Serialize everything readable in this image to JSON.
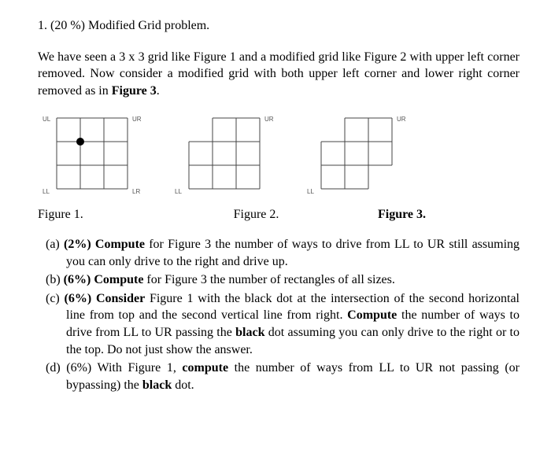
{
  "title": "1. (20 %) Modified Grid problem.",
  "intro_html": "We have seen a 3 x 3 grid like Figure 1 and a modified grid like Figure 2 with upper left corner removed. Now consider a modified grid with both upper left corner and lower right corner removed as in <strong>Figure 3</strong>.",
  "figures": {
    "fig1": {
      "caption": "Figure 1.",
      "labels": {
        "UL": "UL",
        "UR": "UR",
        "LL": "LL",
        "LR": "LR"
      }
    },
    "fig2": {
      "caption": "Figure 2.",
      "labels": {
        "UR": "UR",
        "LL": "LL"
      }
    },
    "fig3": {
      "caption": "Figure 3.",
      "labels": {
        "UR": "UR",
        "LL": "LL"
      }
    }
  },
  "parts": {
    "a": "(a) <strong>(2%) Compute</strong> for Figure 3 the number of ways to drive from LL to UR still assuming you can only drive to the right and drive up.",
    "b": "(b) <strong>(6%) Compute</strong> for Figure 3 the number of rectangles of all sizes.",
    "c": "(c) <strong>(6%) Consider</strong> Figure 1 with the black dot at the intersection of the second horizontal line from top and the second vertical line from right. <strong>Compute</strong> the number of ways to drive from LL to UR passing the <strong>black</strong> dot assuming you can only drive to the right or to the top. Do not just show the answer.",
    "d": "(d) (6%) With Figure 1, <strong>compute</strong> the number of ways from LL to UR not passing (or bypassing) the <strong>black</strong> dot."
  },
  "chart_data": [
    {
      "type": "table",
      "name": "Figure 1",
      "description": "3x3 full grid with corner labels UL, UR, LL, LR and a black dot at intersection (col 2 from left, row 1 from top inside grid lines)",
      "grid_rows": 3,
      "grid_cols": 3,
      "removed_cells": [],
      "dot": {
        "grid_x": 1,
        "grid_y": 1
      }
    },
    {
      "type": "table",
      "name": "Figure 2",
      "description": "3x3 grid with upper-left cell removed",
      "grid_rows": 3,
      "grid_cols": 3,
      "removed_cells": [
        [
          0,
          0
        ]
      ]
    },
    {
      "type": "table",
      "name": "Figure 3",
      "description": "3x3 grid with upper-left and lower-right cells removed",
      "grid_rows": 3,
      "grid_cols": 3,
      "removed_cells": [
        [
          0,
          0
        ],
        [
          2,
          2
        ]
      ]
    }
  ]
}
